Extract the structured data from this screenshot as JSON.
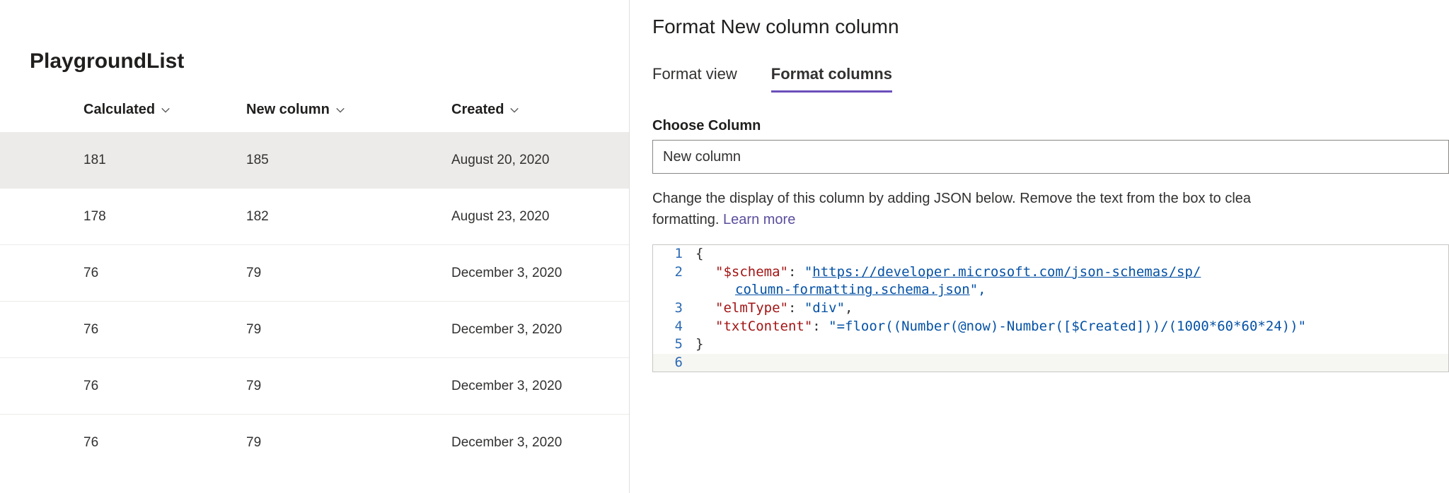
{
  "list": {
    "title": "PlaygroundList",
    "columns": {
      "calculated": "Calculated",
      "new_column": "New column",
      "created": "Created"
    },
    "rows": [
      {
        "calculated": "181",
        "new_column": "185",
        "created": "August 20, 2020"
      },
      {
        "calculated": "178",
        "new_column": "182",
        "created": "August 23, 2020"
      },
      {
        "calculated": "76",
        "new_column": "79",
        "created": "December 3, 2020"
      },
      {
        "calculated": "76",
        "new_column": "79",
        "created": "December 3, 2020"
      },
      {
        "calculated": "76",
        "new_column": "79",
        "created": "December 3, 2020"
      },
      {
        "calculated": "76",
        "new_column": "79",
        "created": "December 3, 2020"
      }
    ]
  },
  "panel": {
    "title": "Format New column column",
    "tabs": {
      "view": "Format view",
      "columns": "Format columns"
    },
    "choose_label": "Choose Column",
    "choose_value": "New column",
    "description_prefix": "Change the display of this column by adding JSON below. Remove the text from the box to clea",
    "description_suffix": "formatting. ",
    "learn_more": "Learn more",
    "code": {
      "line1_open": "{",
      "line2_key": "\"$schema\"",
      "line2_colon": ": ",
      "line2_q": "\"",
      "line2_url_a": "https://developer.microsoft.com/json-schemas/sp/",
      "line2b_url_b": "column-formatting.schema.json",
      "line2b_end": "\",",
      "line3_key": "\"elmType\"",
      "line3_rest": ": \"div\",",
      "line3_colon": ": ",
      "line3_val": "\"div\"",
      "line3_comma": ",",
      "line4_key": "\"txtContent\"",
      "line4_colon": ": ",
      "line4_val": "\"=floor((Number(@now)-Number([$Created]))/(1000*60*60*24))\"",
      "line5_close": "}",
      "ln1": "1",
      "ln2": "2",
      "ln3": "3",
      "ln4": "4",
      "ln5": "5",
      "ln6": "6"
    }
  }
}
